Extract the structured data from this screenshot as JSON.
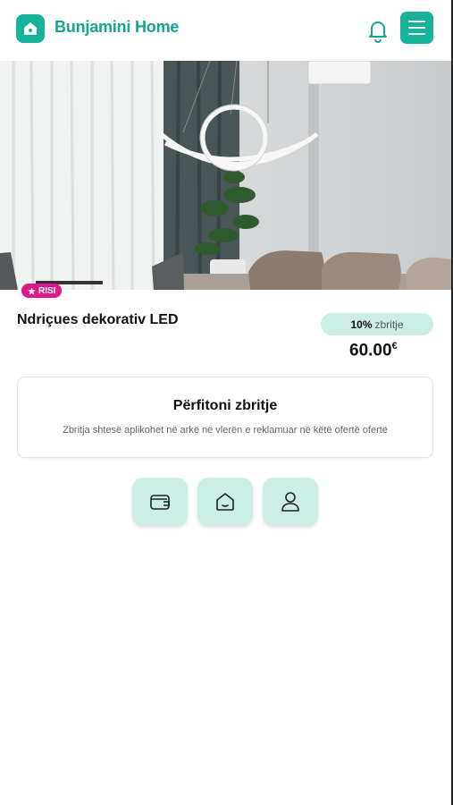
{
  "header": {
    "brand": "Bunjamini Home",
    "icons": {
      "logo": "home-icon",
      "notifications": "bell-icon",
      "menu": "hamburger-menu-icon"
    }
  },
  "hero": {
    "image_description": "Living room with a modern LED ring pendant lamp, sheer curtains, plant and sofa",
    "badge_label": "RISI"
  },
  "product": {
    "title": "Ndriçues dekorativ LED",
    "discount_percent": "10%",
    "discount_label": "zbritje",
    "price": "60.00",
    "currency": "€"
  },
  "promo_card": {
    "title": "Përfitoni zbritje",
    "text": "Zbritja shtesë aplikohet në arkë në vlerën e reklamuar në këtë ofertë ofertë"
  },
  "actions": [
    {
      "icon": "wallet-icon"
    },
    {
      "icon": "home-outline-icon"
    },
    {
      "icon": "user-icon"
    }
  ],
  "colors": {
    "accent": "#16b39a",
    "accent_light": "#cdeee7",
    "badge": "#e0198a"
  }
}
